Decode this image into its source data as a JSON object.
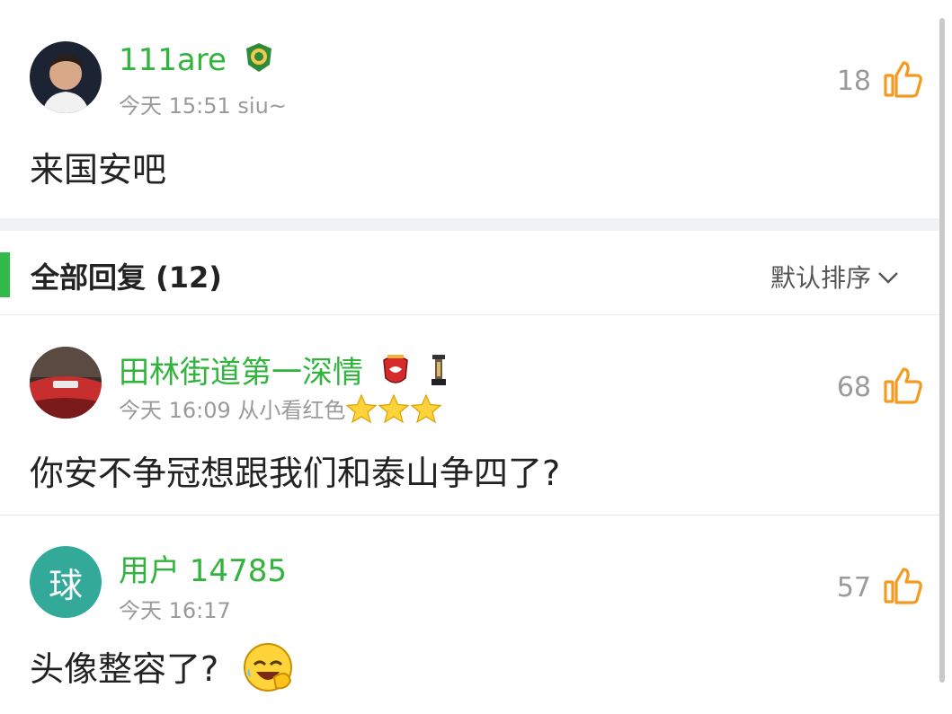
{
  "main_comment": {
    "username": "111are",
    "meta": "今天 15:51 siu~",
    "likes": "18",
    "content": "来国安吧"
  },
  "replies_header": {
    "title": "全部回复 (12)",
    "sort_label": "默认排序"
  },
  "replies": [
    {
      "username": "田林街道第一深情",
      "meta": "今天 16:09 从小看红色",
      "likes": "68",
      "content": "你安不争冠想跟我们和泰山争四了?"
    },
    {
      "avatar_text": "球",
      "username": "用户 14785",
      "meta": "今天 16:17",
      "likes": "57",
      "content": "头像整容了?"
    }
  ],
  "colors": {
    "accent_green": "#30b43c",
    "like_orange": "#f39a1f",
    "avatar_teal": "#33a99a",
    "gray_text": "#9a9a9a"
  },
  "icons": {
    "like": "thumbs-up-icon",
    "badge_main": "guoan-team-badge-icon",
    "badge_reply": "shanghai-port-team-badge-icon",
    "trophy": "trophy-icon",
    "star": "star-icon",
    "emoji": "facepalm-laugh-emoji-icon",
    "sort": "chevron-down-icon"
  }
}
